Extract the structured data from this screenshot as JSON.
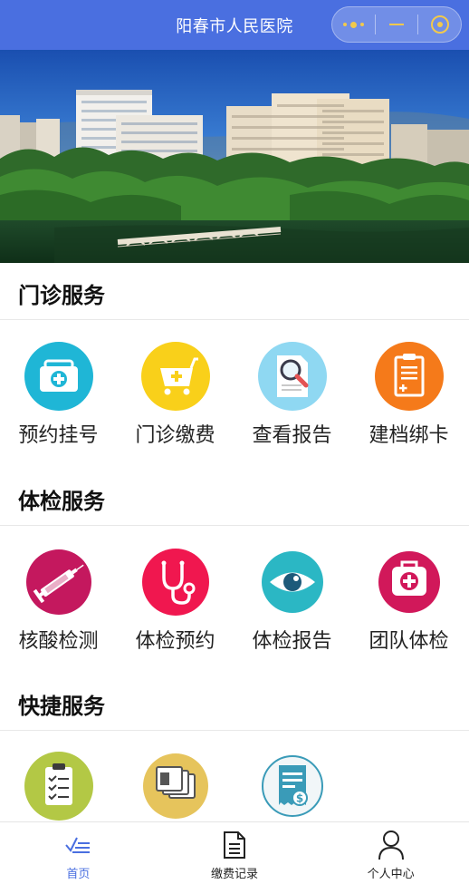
{
  "header": {
    "title": "阳春市人民医院",
    "capsule_icons": [
      "more-dots-icon",
      "minimize-icon",
      "close-ring-icon"
    ]
  },
  "banner": {
    "image": "hospital-buildings-photo"
  },
  "sections": [
    {
      "title": "门诊服务",
      "items": [
        {
          "label": "预约挂号",
          "icon": "medical-kit-icon",
          "color": "#1fb6d6"
        },
        {
          "label": "门诊缴费",
          "icon": "cart-icon",
          "color": "#f9d01a"
        },
        {
          "label": "查看报告",
          "icon": "magnify-report-icon",
          "color": "#8fd8f2"
        },
        {
          "label": "建档绑卡",
          "icon": "clipboard-icon",
          "color": "#f57a1a"
        }
      ]
    },
    {
      "title": "体检服务",
      "items": [
        {
          "label": "核酸检测",
          "icon": "syringe-icon",
          "color": "#c4185e"
        },
        {
          "label": "体检预约",
          "icon": "stethoscope-icon",
          "color": "#f0174f"
        },
        {
          "label": "体检报告",
          "icon": "eye-icon",
          "color": "#2bb7c4"
        },
        {
          "label": "团队体检",
          "icon": "first-aid-kit-icon",
          "color": "#d1185a"
        }
      ]
    },
    {
      "title": "快捷服务",
      "items": [
        {
          "label": "",
          "icon": "checklist-icon",
          "color": "#b3c845"
        },
        {
          "label": "",
          "icon": "cards-icon",
          "color": "#e6c45c"
        },
        {
          "label": "",
          "icon": "receipt-icon",
          "color": "#f1f6f8"
        }
      ]
    }
  ],
  "tabbar": {
    "items": [
      {
        "label": "首页",
        "icon": "home-check-icon",
        "active": true
      },
      {
        "label": "缴费记录",
        "icon": "document-icon",
        "active": false
      },
      {
        "label": "个人中心",
        "icon": "person-icon",
        "active": false
      }
    ]
  },
  "colors": {
    "header": "#4a6fe0",
    "active_tab": "#4a6fe0"
  }
}
